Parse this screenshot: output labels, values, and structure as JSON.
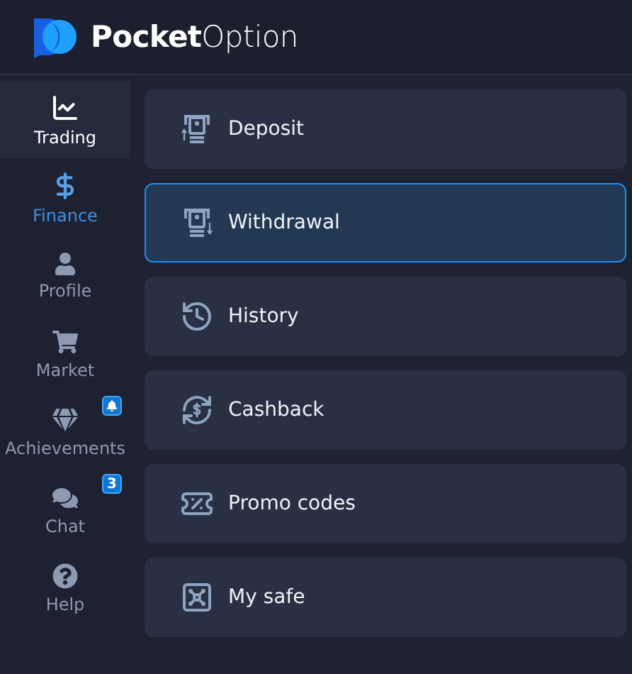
{
  "header": {
    "logo_text": "**Pocket**Option"
  },
  "sidebar": {
    "items": [
      {
        "label": "Trading",
        "selected": false,
        "highlighted": true
      },
      {
        "label": "Finance",
        "selected": true,
        "highlighted": false
      },
      {
        "label": "Profile",
        "selected": false,
        "highlighted": false
      },
      {
        "label": "Market",
        "selected": false,
        "highlighted": false
      },
      {
        "label": "Achievements",
        "selected": false,
        "highlighted": false,
        "badge": {
          "kind": "bell"
        }
      },
      {
        "label": "Chat",
        "selected": false,
        "highlighted": false,
        "badge": {
          "kind": "count",
          "text": "3"
        }
      },
      {
        "label": "Help",
        "selected": false,
        "highlighted": false
      }
    ]
  },
  "menu": {
    "items": [
      {
        "label": "Deposit",
        "selected": false
      },
      {
        "label": "Withdrawal",
        "selected": true
      },
      {
        "label": "History",
        "selected": false
      },
      {
        "label": "Cashback",
        "selected": false
      },
      {
        "label": "Promo codes",
        "selected": false
      },
      {
        "label": "My safe",
        "selected": false
      }
    ]
  }
}
